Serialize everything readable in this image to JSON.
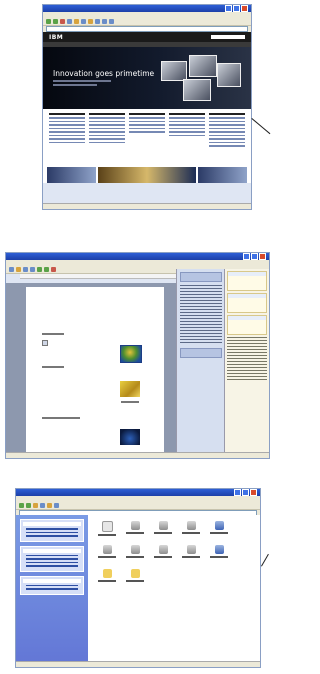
{
  "screenshots": [
    {
      "id": "ie-ibm",
      "header_logo": "IBM",
      "hero_headline": "Innovation goes primetime"
    },
    {
      "id": "word-document"
    },
    {
      "id": "explorer-window"
    }
  ]
}
